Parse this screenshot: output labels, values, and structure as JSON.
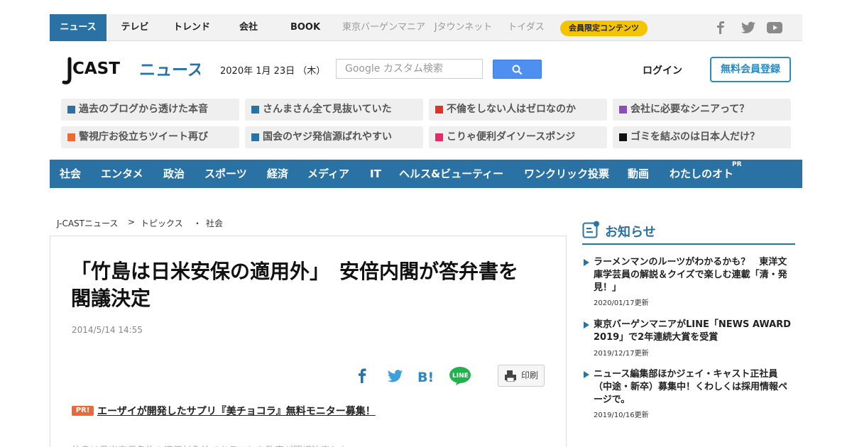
{
  "topnav": {
    "items": [
      "ニュース",
      "テレビ",
      "トレンド",
      "会社",
      "BOOK",
      "東京バーゲンマニア",
      "Jタウンネット",
      "トイダス"
    ],
    "member_badge": "会員限定コンテンツ"
  },
  "header": {
    "logo_j": "J",
    "logo_cast": "CAST",
    "logo_news": "ニュース",
    "date": "2020年 1月 23日 （木）",
    "search_placeholder": "Google カスタム検索",
    "login": "ログイン",
    "register": "無料会員登録"
  },
  "trends": [
    {
      "label": "過去のブログから透けた本音",
      "color": "#2a72a4"
    },
    {
      "label": "さんまさん全て見抜いていた",
      "color": "#2a72a4"
    },
    {
      "label": "不倫をしない人はゼロなのか",
      "color": "#e0312b"
    },
    {
      "label": "会社に必要なシニアって？",
      "color": "#8a4fb0"
    },
    {
      "label": "警視庁お役立ちツイート再び",
      "color": "#f06a2c"
    },
    {
      "label": "国会のヤジ発信源ばれやすい",
      "color": "#2a72a4"
    },
    {
      "label": "こりゃ便利ダイソースポンジ",
      "color": "#e52a6a"
    },
    {
      "label": "ゴミを結ぶのは日本人だけ？",
      "color": "#111111"
    }
  ],
  "categories": [
    "社会",
    "エンタメ",
    "政治",
    "スポーツ",
    "経済",
    "メディア",
    "IT",
    "ヘルス&ビューティー",
    "ワンクリック投票",
    "動画",
    "わたしのオト"
  ],
  "category_pr": "PR",
  "breadcrumb": [
    "J-CASTニュース",
    ">",
    "トピックス",
    "・",
    "社会"
  ],
  "article": {
    "title_line1": "「竹島は日米安保の適用外」　安倍内閣が答弁書を",
    "title_line2": "閣議決定",
    "date": "2014/5/14 14:55",
    "print": "印刷",
    "pr_tag": "PR!",
    "pr_link": "エーザイが開発したサプリ『美チョコラ』無料モニター募集！",
    "body_start": "竹島は日米安保条約の適用対象外であることを政府が閣議決定した。"
  },
  "sidebar": {
    "notice_title": "お知らせ",
    "notices": [
      {
        "text": "ラーメンマンのルーツがわかるかも？　東洋文庫学芸員の解説＆クイズで楽しむ連載「清・発見！」",
        "updated": "2020/01/17更新"
      },
      {
        "text": "東京バーゲンマニアがLINE「NEWS AWARD 2019」で2年連続大賞を受賞",
        "updated": "2019/12/17更新"
      },
      {
        "text": "ニュース編集部ほかジェイ・キャスト正社員（中途・新卒）募集中！くわしくは採用情報ページで。",
        "updated": "2019/10/16更新"
      }
    ]
  },
  "colors": {
    "brand": "#2a72a4",
    "accent": "#f5c400",
    "pr": "#e8693a"
  }
}
